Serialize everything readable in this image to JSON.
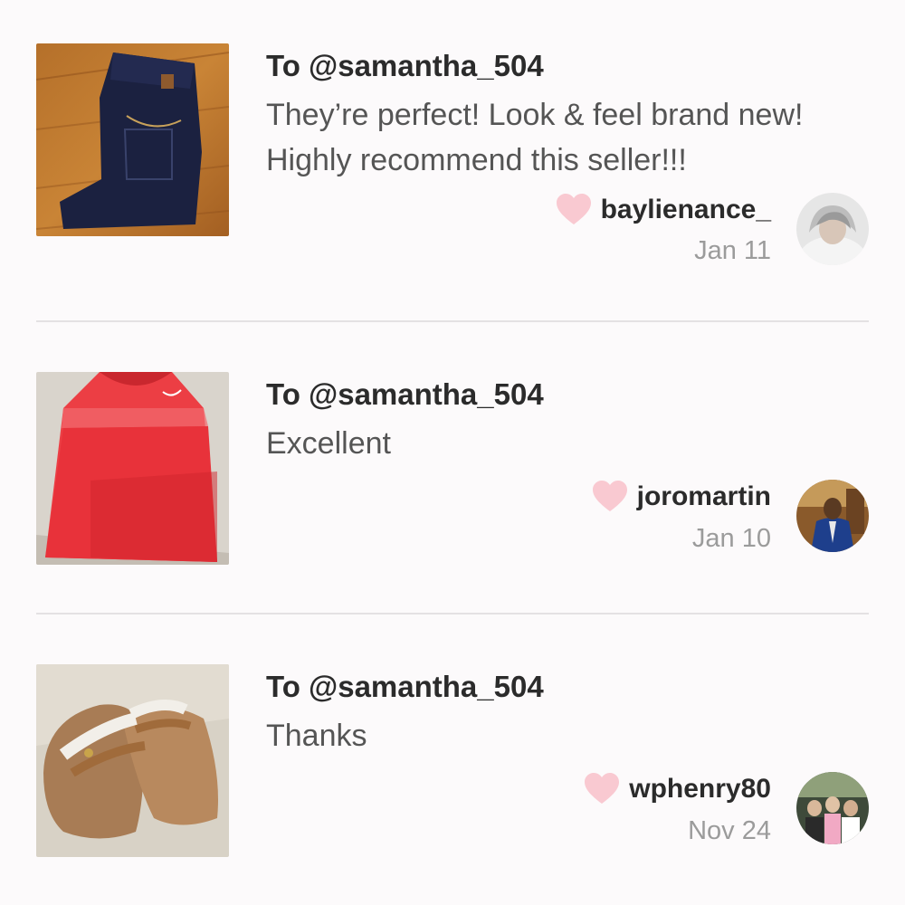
{
  "reviews": [
    {
      "recipient": "To @samantha_504",
      "message": "They’re perfect! Look & feel brand new! Highly recommend this seller!!!",
      "username": "baylienance_",
      "date": "Jan 11",
      "item_image": "jeans-photo",
      "avatar_image": "user-photo"
    },
    {
      "recipient": "To @samantha_504",
      "message": "Excellent",
      "username": "joromartin",
      "date": "Jan 10",
      "item_image": "tank-top-photo",
      "avatar_image": "user-photo"
    },
    {
      "recipient": "To @samantha_504",
      "message": "Thanks",
      "username": "wphenry80",
      "date": "Nov 24",
      "item_image": "sandals-photo",
      "avatar_image": "user-photo"
    }
  ],
  "colors": {
    "heart": "#f9c9d1",
    "text_primary": "#2b2b2b",
    "text_secondary": "#555555",
    "date": "#9b9b9b",
    "divider": "#e4e1e3",
    "background": "#fcfafb"
  }
}
